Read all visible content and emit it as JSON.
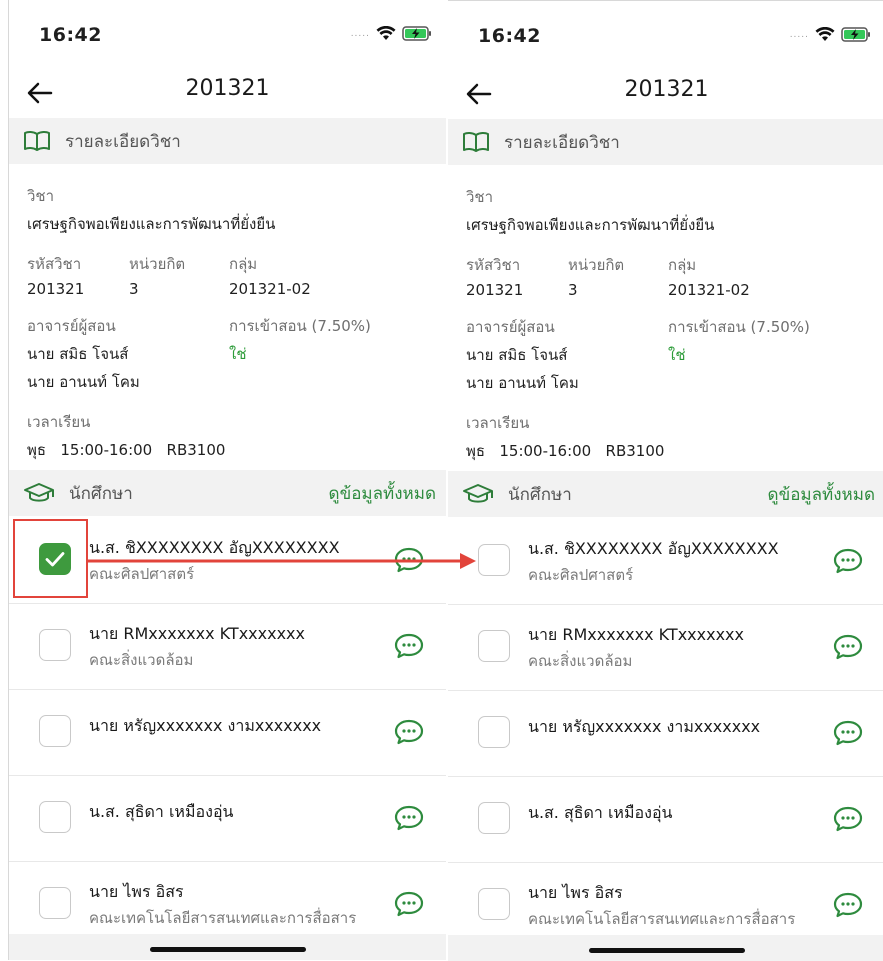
{
  "status": {
    "time": "16:42",
    "signal": "....."
  },
  "nav": {
    "title": "201321"
  },
  "course_section": {
    "label": "รายละเอียดวิชา"
  },
  "course": {
    "subject_label": "วิชา",
    "subject_value": "เศรษฐกิจพอเพียงและการพัฒนาที่ยั่งยืน",
    "code_label": "รหัสวิชา",
    "code_value": "201321",
    "credit_label": "หน่วยกิต",
    "credit_value": "3",
    "group_label": "กลุ่ม",
    "group_value": "201321-02",
    "instructor_label": "อาจารย์ผู้สอน",
    "instructors": [
      "นาย สมิธ โจนส์",
      "นาย อานนท์ โคม"
    ],
    "attendance_label": "การเข้าสอน (7.50%)",
    "attendance_value": "ใช่",
    "time_label": "เวลาเรียน",
    "time_day": "พุธ",
    "time_range": "15:00-16:00",
    "time_room": "RB3100"
  },
  "students_section": {
    "label": "นักศึกษา",
    "view_all": "ดูข้อมูลทั้งหมด"
  },
  "students": [
    {
      "name": "น.ส. ชิXXXXXXXX อัญXXXXXXXX",
      "faculty": "คณะศิลปศาสตร์"
    },
    {
      "name": "นาย RMxxxxxxx KTxxxxxxx",
      "faculty": "คณะสิ่งแวดล้อม"
    },
    {
      "name": "นาย หรัญxxxxxxx งามxxxxxxx",
      "faculty": ""
    },
    {
      "name": "น.ส. สุธิดา เหมืองอุ่น",
      "faculty": ""
    },
    {
      "name": "นาย ไพร อิสร",
      "faculty": "คณะเทคโนโลยีสารสนเทศและการสื่อสาร"
    }
  ],
  "left_checked": [
    true,
    false,
    false,
    false,
    false
  ],
  "right_checked": [
    false,
    false,
    false,
    false,
    false
  ],
  "colors": {
    "accent": "#2e9c3a",
    "checkbox_checked": "#3e9a3e",
    "annotation": "#e2443b"
  },
  "icons": [
    "back-arrow-icon",
    "book-icon",
    "graduation-cap-icon",
    "chat-bubble-icon",
    "wifi-icon",
    "battery-charging-icon",
    "checkmark-icon"
  ]
}
